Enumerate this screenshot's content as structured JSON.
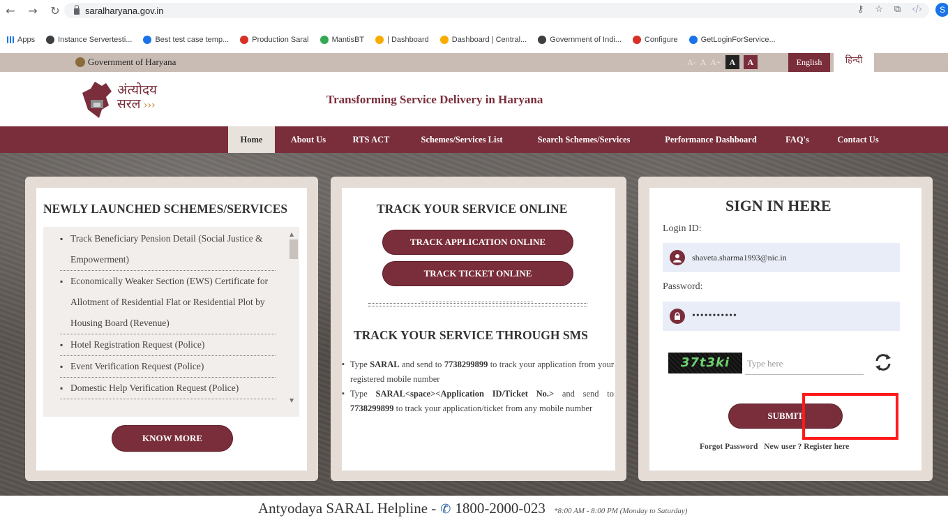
{
  "browser": {
    "url": "saralharyana.gov.in",
    "profile_initial": "S",
    "bookmarks": [
      {
        "label": "Apps",
        "color": "#5f6368"
      },
      {
        "label": "Instance Servertesti...",
        "color": "#3c4043"
      },
      {
        "label": "Best test case temp...",
        "color": "#1a73e8"
      },
      {
        "label": "Production Saral",
        "color": "#d93025"
      },
      {
        "label": "MantisBT",
        "color": "#34a853"
      },
      {
        "label": "| Dashboard",
        "color": "#f9ab00"
      },
      {
        "label": "Dashboard | Central...",
        "color": "#f9ab00"
      },
      {
        "label": "Government of Indi...",
        "color": "#3c4043"
      },
      {
        "label": "Configure",
        "color": "#d93025"
      },
      {
        "label": "GetLoginForService...",
        "color": "#1a73e8"
      }
    ]
  },
  "topbar": {
    "gov_name": "Government of Haryana",
    "font_controls": [
      "A-",
      "A",
      "A+",
      "A",
      "A"
    ],
    "lang_english": "English",
    "lang_hindi": "हिन्दी"
  },
  "header": {
    "logo_text_line1": "अंत्योदय",
    "logo_text_line2": "सरल",
    "tagline": "Transforming Service Delivery in Haryana"
  },
  "nav": {
    "items": [
      "Home",
      "About Us",
      "RTS ACT",
      "Schemes/Services List",
      "Search Schemes/Services",
      "Performance Dashboard",
      "FAQ's",
      "Contact Us"
    ]
  },
  "schemes": {
    "title": "NEWLY LAUNCHED SCHEMES/SERVICES",
    "items": [
      "Track Beneficiary Pension Detail (Social Justice & Empowerment)",
      "Economically Weaker Section (EWS) Certificate for Allotment of Residential Flat or Residential Plot by Housing Board (Revenue)",
      "Hotel Registration Request (Police)",
      "Event Verification Request (Police)",
      "Domestic Help Verification Request (Police)"
    ],
    "button": "KNOW MORE"
  },
  "track": {
    "title": "TRACK YOUR SERVICE ONLINE",
    "btn_application": "TRACK APPLICATION ONLINE",
    "btn_ticket": "TRACK TICKET ONLINE",
    "sms_title": "TRACK YOUR SERVICE THROUGH SMS",
    "sms_1_pre": "Type ",
    "sms_1_key": "SARAL",
    "sms_1_mid": " and send to ",
    "sms_1_num": "7738299899",
    "sms_1_post": " to track your application from your registered mobile number",
    "sms_2_key": "SARAL<space><Application ID/Ticket No.>",
    "sms_2_mid": " and send to ",
    "sms_2_num": "7738299899",
    "sms_2_post": " to track your application/ticket from any mobile number"
  },
  "signin": {
    "title": "SIGN IN HERE",
    "login_label": "Login ID:",
    "login_value": "shaveta.sharma1993@nic.in",
    "password_label": "Password:",
    "password_value": "•••••••••••",
    "captcha_text": "37t3ki",
    "captcha_placeholder": "Type here",
    "submit": "SUBMIT",
    "forgot": "Forgot Password",
    "new_user": "New user ? Register here"
  },
  "footer": {
    "helpline_label": "Antyodaya SARAL Helpline -",
    "helpline_number": "1800-2000-023",
    "hours": "*8:00 AM - 8:00 PM (Monday to Saturday)"
  },
  "colors": {
    "maroon": "#7a2d3a",
    "highlight": "#ff1a1a"
  }
}
